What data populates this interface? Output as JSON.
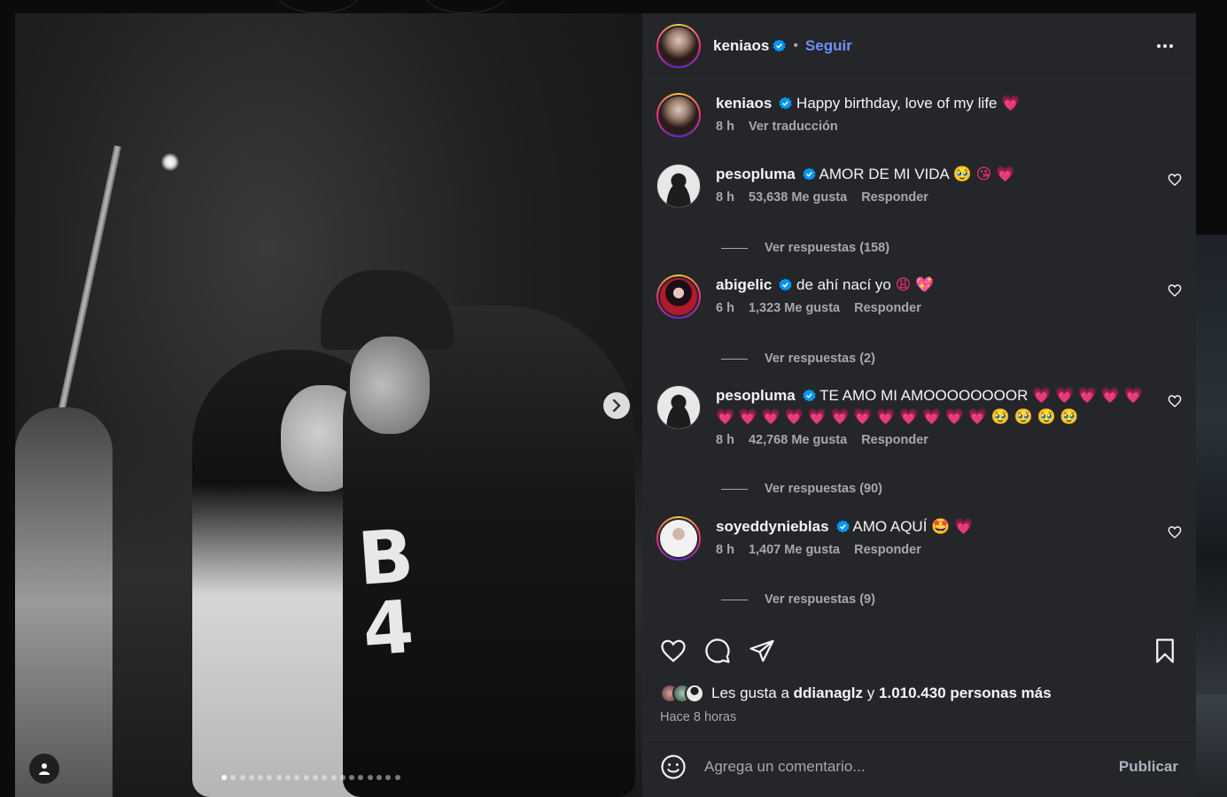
{
  "post": {
    "author": "keniaos",
    "follow_label": "Seguir",
    "separator": "•",
    "carousel_total": 20,
    "carousel_active": 1
  },
  "comments": [
    {
      "username": "keniaos",
      "text": "Happy birthday, love of my life",
      "emoji": "💗",
      "time": "8 h",
      "extra_link": "Ver traducción"
    },
    {
      "username": "pesopluma",
      "text": "AMOR DE MI VIDA",
      "emoji": "🥹 😘 💗",
      "time": "8 h",
      "likes": "53,638 Me gusta",
      "reply_label": "Responder",
      "replies": "Ver respuestas (158)"
    },
    {
      "username": "abigelic",
      "text": "de ahí nací yo",
      "emoji": "😩 💖",
      "time": "6 h",
      "likes": "1,323 Me gusta",
      "reply_label": "Responder",
      "replies": "Ver respuestas (2)"
    },
    {
      "username": "pesopluma",
      "text": "TE AMO MI AMOOOOOOOOR",
      "emoji": "💗 💗 💗 💗 💗 💗 💗 💗 💗 💗 💗 💗 💗 💗 💗 💗 💗 🥹 🥹 🥹 🥹",
      "time": "8 h",
      "likes": "42,768 Me gusta",
      "reply_label": "Responder",
      "replies": "Ver respuestas (90)"
    },
    {
      "username": "soyeddynieblas",
      "text": "AMO AQUÍ",
      "emoji": "🤩 💗",
      "time": "8 h",
      "likes": "1,407 Me gusta",
      "reply_label": "Responder",
      "replies": "Ver respuestas (9)"
    }
  ],
  "likes_summary": {
    "prefix": "Les gusta a",
    "user": "ddianaglz",
    "conj": "y",
    "count": "1.010.430 personas más"
  },
  "posted_ago": "Hace 8 horas",
  "comment_input": {
    "placeholder": "Agrega un comentario...",
    "publish_label": "Publicar"
  },
  "icons": {
    "verified": "verified-badge-icon",
    "heart": "heart-icon",
    "comment": "comment-icon",
    "share": "send-icon",
    "save": "bookmark-icon",
    "emoji": "emoji-icon",
    "more": "more-options-icon",
    "next": "chevron-right-icon",
    "tag": "user-tag-icon"
  },
  "colors": {
    "link_blue": "#708dff",
    "verified_blue": "#0095f6",
    "panel_bg": "#242629"
  }
}
